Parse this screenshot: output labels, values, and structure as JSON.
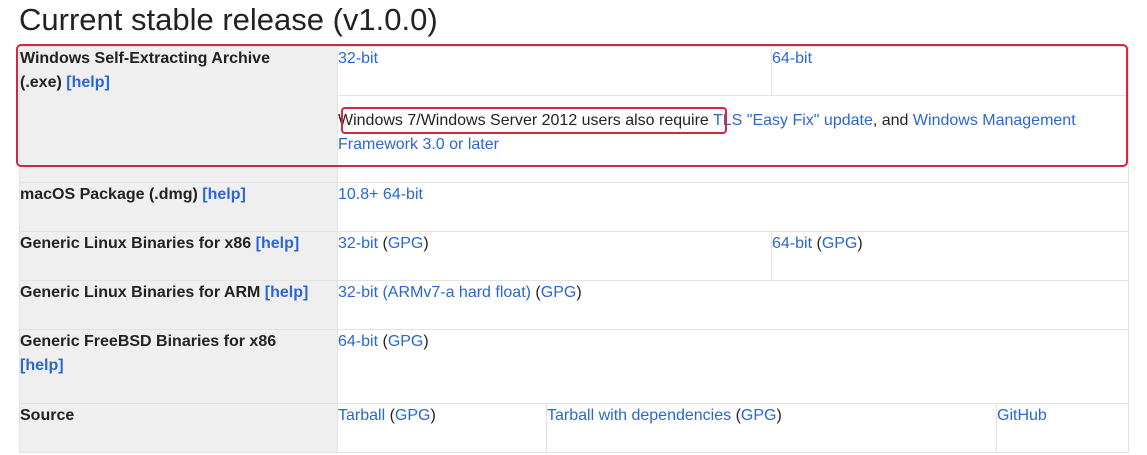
{
  "heading": "Current stable release (v1.0.0)",
  "help_label": "[help]",
  "gpg_label": "GPG",
  "rows": {
    "windows": {
      "label_line1": "Windows Self-Extracting Archive",
      "label_line2": "(.exe)",
      "link_32": "32-bit",
      "link_64": "64-bit",
      "note_text": "Windows 7/Windows Server 2012 users also require",
      "note_link1": "TLS \"Easy Fix\" update",
      "note_and": ", and",
      "note_link2": "Windows Management Framework 3.0 or later"
    },
    "macos": {
      "label": "macOS Package (.dmg)",
      "link": "10.8+ 64-bit"
    },
    "linux_x86": {
      "label": "Generic Linux Binaries for x86",
      "link_32": "32-bit",
      "link_64": "64-bit"
    },
    "linux_arm": {
      "label": "Generic Linux Binaries for ARM",
      "link": "32-bit (ARMv7-a hard float)"
    },
    "freebsd": {
      "label": "Generic FreeBSD Binaries for x86",
      "link": "64-bit"
    },
    "source": {
      "label": "Source",
      "tarball": "Tarball",
      "tarball_deps": "Tarball with dependencies",
      "github": "GitHub"
    }
  },
  "colors": {
    "link": "#2a66d6",
    "highlight": "#d6263f",
    "label_bg": "#efefef"
  }
}
